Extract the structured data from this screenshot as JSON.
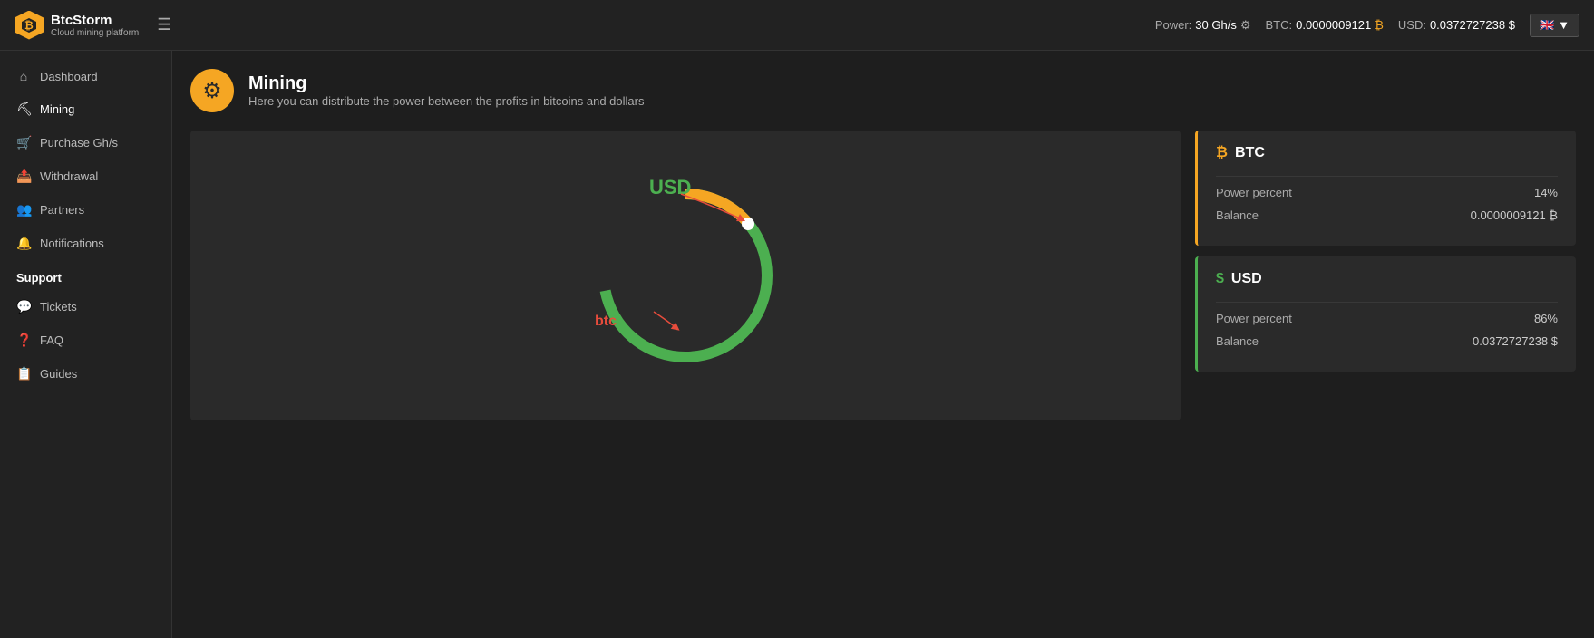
{
  "topbar": {
    "logo_title": "BtcStorm",
    "logo_sub": "Cloud mining platform",
    "power_label": "Power:",
    "power_value": "30 Gh/s",
    "btc_label": "BTC:",
    "btc_value": "0.0000009121",
    "usd_label": "USD:",
    "usd_value": "0.0372727238 $",
    "flag": "🇬🇧",
    "chevron": "▼"
  },
  "sidebar": {
    "items": [
      {
        "id": "dashboard",
        "label": "Dashboard",
        "icon": "⌂"
      },
      {
        "id": "mining",
        "label": "Mining",
        "icon": "⛏"
      },
      {
        "id": "purchase",
        "label": "Purchase Gh/s",
        "icon": "🛒"
      },
      {
        "id": "withdrawal",
        "label": "Withdrawal",
        "icon": "📷"
      },
      {
        "id": "partners",
        "label": "Partners",
        "icon": "👥"
      },
      {
        "id": "notifications",
        "label": "Notifications",
        "icon": "🔔"
      }
    ],
    "support_label": "Support",
    "support_items": [
      {
        "id": "tickets",
        "label": "Tickets",
        "icon": "💬"
      },
      {
        "id": "faq",
        "label": "FAQ",
        "icon": "❓"
      },
      {
        "id": "guides",
        "label": "Guides",
        "icon": "📋"
      }
    ]
  },
  "page": {
    "title": "Mining",
    "subtitle": "Here you can distribute the power between the profits in bitcoins and dollars"
  },
  "chart": {
    "usd_label": "USD",
    "btc_label": "btc",
    "btc_percent": 14,
    "usd_percent": 86
  },
  "btc_card": {
    "title": "BTC",
    "power_percent_label": "Power percent",
    "power_percent_value": "14%",
    "balance_label": "Balance",
    "balance_value": "0.0000009121 ₿"
  },
  "usd_card": {
    "title": "USD",
    "power_percent_label": "Power percent",
    "power_percent_value": "86%",
    "balance_label": "Balance",
    "balance_value": "0.0372727238 $"
  }
}
